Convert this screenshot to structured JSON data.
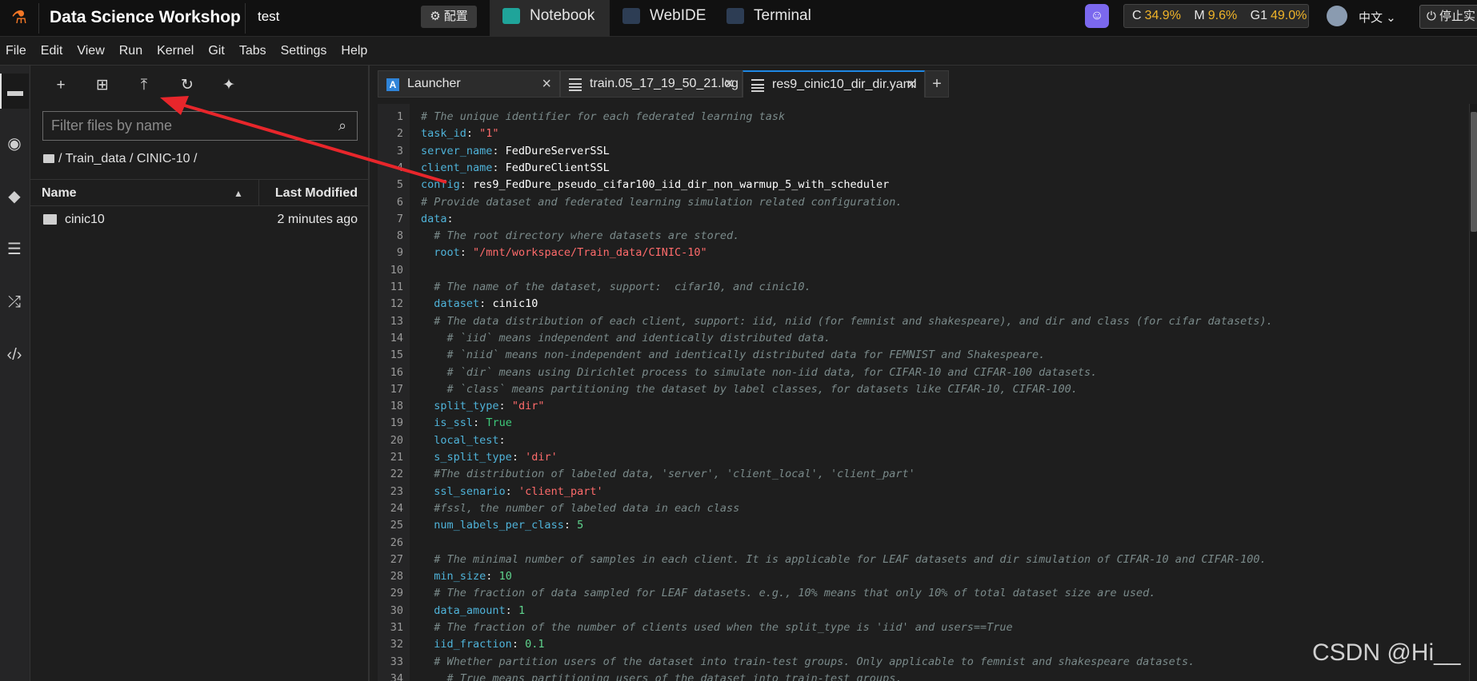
{
  "topbar": {
    "brand": "Data Science Workshop",
    "project": "test",
    "config_label": "⚙ 配置",
    "tabs": [
      {
        "label": "Notebook",
        "active": true
      },
      {
        "label": "WebIDE",
        "active": false
      },
      {
        "label": "Terminal",
        "active": false
      }
    ],
    "usage": {
      "c_label": "C",
      "c_value": "34.9%",
      "m_label": "M",
      "m_value": "9.6%",
      "g_label": "G1",
      "g_value": "49.0%"
    },
    "language": "中文 ⌄",
    "stop_label": "⏻ 停止实"
  },
  "menu": [
    "File",
    "Edit",
    "View",
    "Run",
    "Kernel",
    "Git",
    "Tabs",
    "Settings",
    "Help"
  ],
  "sidebar_icons": [
    "folder-icon",
    "running-icon",
    "git-icon",
    "toc-icon",
    "extension-icon",
    "code-icon"
  ],
  "filebrowser": {
    "filter_placeholder": "Filter files by name",
    "breadcrumb": "/ Train_data / CINIC-10 /",
    "col_name": "Name",
    "col_modified": "Last Modified",
    "files": [
      {
        "name": "cinic10",
        "modified": "2 minutes ago"
      }
    ]
  },
  "editor": {
    "tabs": [
      {
        "label": "Launcher"
      },
      {
        "label": "train.05_17_19_50_21.log"
      },
      {
        "label": "res9_cinic10_dir_dir.yaml"
      }
    ],
    "lines": [
      [
        [
          "cm",
          "# The unique identifier for each federated learning task"
        ]
      ],
      [
        [
          "k",
          "task_id"
        ],
        [
          "p",
          ": "
        ],
        [
          "s",
          "\"1\""
        ]
      ],
      [
        [
          "k",
          "server_name"
        ],
        [
          "p",
          ": "
        ],
        [
          "v",
          "FedDureServerSSL"
        ]
      ],
      [
        [
          "k",
          "client_name"
        ],
        [
          "p",
          ": "
        ],
        [
          "v",
          "FedDureClientSSL"
        ]
      ],
      [
        [
          "k",
          "config"
        ],
        [
          "p",
          ": "
        ],
        [
          "v",
          "res9_FedDure_pseudo_cifar100_iid_dir_non_warmup_5_with_scheduler"
        ]
      ],
      [
        [
          "cm",
          "# Provide dataset and federated learning simulation related configuration."
        ]
      ],
      [
        [
          "k",
          "data"
        ],
        [
          "p",
          ":"
        ]
      ],
      [
        [
          "cm",
          "  # The root directory where datasets are stored."
        ]
      ],
      [
        [
          "p",
          "  "
        ],
        [
          "k",
          "root"
        ],
        [
          "p",
          ": "
        ],
        [
          "s",
          "\"/mnt/workspace/Train_data/CINIC-10\""
        ]
      ],
      [
        [
          "p",
          ""
        ]
      ],
      [
        [
          "cm",
          "  # The name of the dataset, support:  cifar10, and cinic10."
        ]
      ],
      [
        [
          "p",
          "  "
        ],
        [
          "k",
          "dataset"
        ],
        [
          "p",
          ": "
        ],
        [
          "v",
          "cinic10"
        ]
      ],
      [
        [
          "cm",
          "  # The data distribution of each client, support: iid, niid (for femnist and shakespeare), and dir and class (for cifar datasets)."
        ]
      ],
      [
        [
          "cm",
          "    # `iid` means independent and identically distributed data."
        ]
      ],
      [
        [
          "cm",
          "    # `niid` means non-independent and identically distributed data for FEMNIST and Shakespeare."
        ]
      ],
      [
        [
          "cm",
          "    # `dir` means using Dirichlet process to simulate non-iid data, for CIFAR-10 and CIFAR-100 datasets."
        ]
      ],
      [
        [
          "cm",
          "    # `class` means partitioning the dataset by label classes, for datasets like CIFAR-10, CIFAR-100."
        ]
      ],
      [
        [
          "p",
          "  "
        ],
        [
          "k",
          "split_type"
        ],
        [
          "p",
          ": "
        ],
        [
          "s",
          "\"dir\""
        ]
      ],
      [
        [
          "p",
          "  "
        ],
        [
          "k",
          "is_ssl"
        ],
        [
          "p",
          ": "
        ],
        [
          "b",
          "True"
        ]
      ],
      [
        [
          "p",
          "  "
        ],
        [
          "k",
          "local_test"
        ],
        [
          "p",
          ":"
        ]
      ],
      [
        [
          "p",
          "  "
        ],
        [
          "k",
          "s_split_type"
        ],
        [
          "p",
          ": "
        ],
        [
          "s",
          "'dir'"
        ]
      ],
      [
        [
          "cm",
          "  #The distribution of labeled data, 'server', 'client_local', 'client_part'"
        ]
      ],
      [
        [
          "p",
          "  "
        ],
        [
          "k",
          "ssl_senario"
        ],
        [
          "p",
          ": "
        ],
        [
          "s",
          "'client_part'"
        ]
      ],
      [
        [
          "cm",
          "  #fssl, the number of labeled data in each class"
        ]
      ],
      [
        [
          "p",
          "  "
        ],
        [
          "k",
          "num_labels_per_class"
        ],
        [
          "p",
          ": "
        ],
        [
          "n",
          "5"
        ]
      ],
      [
        [
          "p",
          ""
        ]
      ],
      [
        [
          "cm",
          "  # The minimal number of samples in each client. It is applicable for LEAF datasets and dir simulation of CIFAR-10 and CIFAR-100."
        ]
      ],
      [
        [
          "p",
          "  "
        ],
        [
          "k",
          "min_size"
        ],
        [
          "p",
          ": "
        ],
        [
          "n",
          "10"
        ]
      ],
      [
        [
          "cm",
          "  # The fraction of data sampled for LEAF datasets. e.g., 10% means that only 10% of total dataset size are used."
        ]
      ],
      [
        [
          "p",
          "  "
        ],
        [
          "k",
          "data_amount"
        ],
        [
          "p",
          ": "
        ],
        [
          "n",
          "1"
        ]
      ],
      [
        [
          "cm",
          "  # The fraction of the number of clients used when the split_type is 'iid' and users==True"
        ]
      ],
      [
        [
          "p",
          "  "
        ],
        [
          "k",
          "iid_fraction"
        ],
        [
          "p",
          ": "
        ],
        [
          "n",
          "0.1"
        ]
      ],
      [
        [
          "cm",
          "  # Whether partition users of the dataset into train-test groups. Only applicable to femnist and shakespeare datasets."
        ]
      ],
      [
        [
          "cm",
          "    # True means partitioning users of the dataset into train-test groups."
        ]
      ]
    ]
  },
  "watermark": "CSDN @Hi__"
}
